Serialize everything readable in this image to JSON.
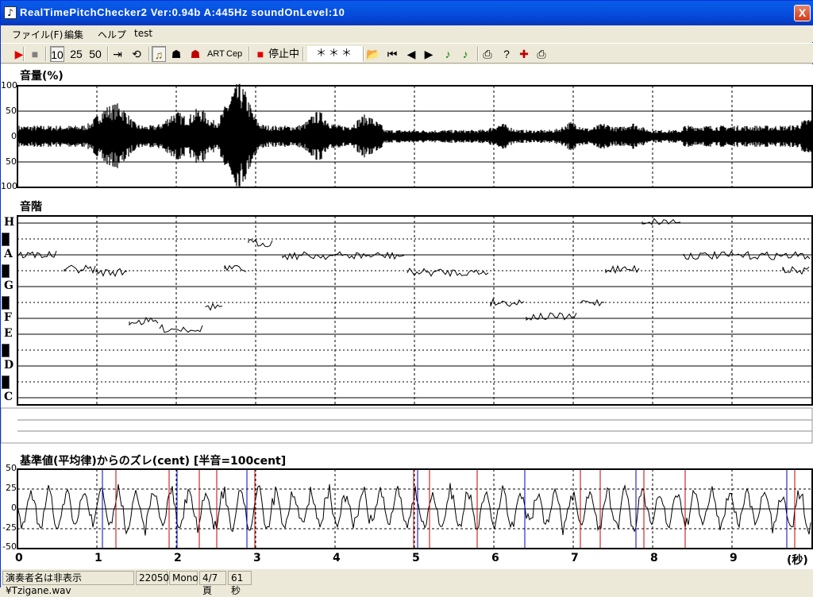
{
  "window": {
    "title": "RealTimePitchChecker2   Ver:0.94b      A:445Hz     soundOnLevel:10",
    "close_label": "X"
  },
  "menu": [
    "ファイル(F)",
    "編集",
    "ヘルプ",
    "test"
  ],
  "toolbar": {
    "buttons": [
      {
        "name": "play-icon",
        "glyph": "▶",
        "color": "#e00000"
      },
      {
        "name": "stop-icon",
        "glyph": "■",
        "color": "#808080"
      },
      {
        "name": "speed-10-button",
        "glyph": "10"
      },
      {
        "name": "speed-25-button",
        "glyph": "25"
      },
      {
        "name": "speed-50-button",
        "glyph": "50"
      },
      {
        "name": "jump-end-icon",
        "glyph": "⇥"
      },
      {
        "name": "loop-icon",
        "glyph": "⟲"
      },
      {
        "name": "violin-icon",
        "glyph": "♫",
        "color": "#7a5a00"
      },
      {
        "name": "singer-icon",
        "glyph": "☗"
      },
      {
        "name": "singer-red-icon",
        "glyph": "☗",
        "color": "#c00000"
      },
      {
        "name": "art-button",
        "glyph": "ART"
      },
      {
        "name": "cep-button",
        "glyph": "Cep"
      },
      {
        "name": "record-stop-icon",
        "glyph": "■",
        "color": "#e00000"
      },
      {
        "name": "open-folder-icon",
        "glyph": "📂"
      },
      {
        "name": "first-page-icon",
        "glyph": "⏮"
      },
      {
        "name": "prev-page-icon",
        "glyph": "◀"
      },
      {
        "name": "next-page-icon",
        "glyph": "▶"
      },
      {
        "name": "note-green-icon",
        "glyph": "♪",
        "color": "#008000"
      },
      {
        "name": "note-green2-icon",
        "glyph": "♪",
        "color": "#008000"
      },
      {
        "name": "print-icon",
        "glyph": "⎙"
      },
      {
        "name": "help-icon",
        "glyph": "?"
      },
      {
        "name": "marker-icon",
        "glyph": "✚",
        "color": "#c00000"
      },
      {
        "name": "print2-icon",
        "glyph": "⎙"
      }
    ],
    "status_label": "停止中",
    "status_value": "＊＊＊"
  },
  "volume_panel": {
    "title": "音量(%)",
    "y_labels": [
      "100",
      "50",
      "0",
      "50",
      "100"
    ]
  },
  "scale_panel": {
    "title": "音階",
    "notes": [
      "H",
      "A",
      "G",
      "F",
      "E",
      "D",
      "C"
    ]
  },
  "deviation_panel": {
    "title": "基準値(平均律)からのズレ(cent) [半音=100cent]",
    "y_labels": [
      "50",
      "25",
      "0",
      "-25",
      "-50"
    ]
  },
  "x_axis": {
    "ticks": [
      "0",
      "1",
      "2",
      "3",
      "4",
      "5",
      "6",
      "7",
      "8",
      "9"
    ],
    "unit": "(秒)"
  },
  "statusbar": {
    "file": "演奏者名は非表示¥Tzigane.wav",
    "rate": "22050",
    "channels": "Mono",
    "page": "4/7頁",
    "duration": "61秒"
  }
}
